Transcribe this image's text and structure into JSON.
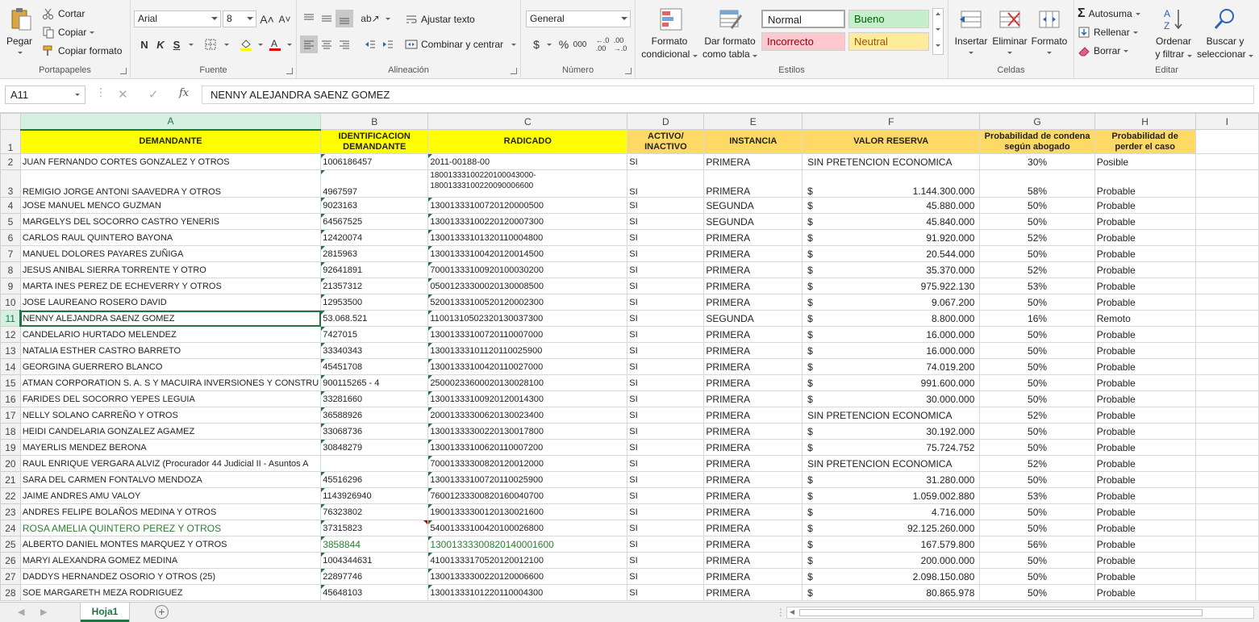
{
  "ribbon": {
    "clipboard": {
      "paste": "Pegar",
      "cut": "Cortar",
      "copy": "Copiar",
      "format_painter": "Copiar formato",
      "group": "Portapapeles"
    },
    "font": {
      "name": "Arial",
      "size": "8",
      "group": "Fuente",
      "bold": "N",
      "italic": "K",
      "underline": "S"
    },
    "alignment": {
      "wrap": "Ajustar texto",
      "merge": "Combinar y centrar",
      "group": "Alineación"
    },
    "number": {
      "format": "General",
      "currency": "$",
      "percent": "%",
      "thousands": "000",
      "group": "Número"
    },
    "styles": {
      "conditional": "Formato condicional",
      "conditional_l1": "Formato",
      "conditional_l2": "condicional",
      "table_l1": "Dar formato",
      "table_l2": "como tabla",
      "normal": "Normal",
      "good": "Bueno",
      "bad": "Incorrecto",
      "neutral": "Neutral",
      "group": "Estilos"
    },
    "cells": {
      "insert": "Insertar",
      "delete": "Eliminar",
      "format": "Formato",
      "group": "Celdas"
    },
    "editing": {
      "autosum": "Autosuma",
      "fill": "Rellenar",
      "clear": "Borrar",
      "sort_l1": "Ordenar",
      "sort_l2": "y filtrar",
      "find_l1": "Buscar y",
      "find_l2": "seleccionar",
      "group": "Editar"
    }
  },
  "formula_bar": {
    "name_box": "A11",
    "cancel": "✕",
    "enter": "✓",
    "fx": "fx",
    "value": "NENNY ALEJANDRA SAENZ GOMEZ"
  },
  "columns": [
    "A",
    "B",
    "C",
    "D",
    "E",
    "F",
    "G",
    "H",
    "I"
  ],
  "header_row": {
    "A": "DEMANDANTE",
    "B": "IDENTIFICACION DEMANDANTE",
    "C": "RADICADO",
    "D": "ACTIVO/ INACTIVO",
    "E": "INSTANCIA",
    "F": "VALOR RESERVA",
    "G": "Probabilidad de condena según abogado",
    "H": "Probabilidad de perder el caso"
  },
  "currency_symbol": "$",
  "rows": [
    {
      "n": "2",
      "a": "JUAN FERNANDO CORTES GONZALEZ Y OTROS",
      "b": "1006186457",
      "c": "2011-00188-00",
      "d": "SI",
      "e": "PRIMERA",
      "f": "SIN PRETENCION ECONOMICA",
      "g": "30%",
      "h": "Posible"
    },
    {
      "n": "3",
      "a": "REMIGIO JORGE ANTONI SAAVEDRA Y OTROS",
      "b": "4967597",
      "c": "18001333100220100043000- 18001333100220090006600",
      "d": "SI",
      "e": "PRIMERA",
      "f": "1.144.300.000",
      "g": "58%",
      "h": "Probable"
    },
    {
      "n": "4",
      "a": "JOSE MANUEL MENCO GUZMAN",
      "b": "9023163",
      "c": "13001333100720120000500",
      "d": "SI",
      "e": "SEGUNDA",
      "f": "45.880.000",
      "g": "50%",
      "h": "Probable"
    },
    {
      "n": "5",
      "a": "MARGELYS DEL SOCORRO CASTRO YENERIS",
      "b": "64567525",
      "c": "13001333100220120007300",
      "d": "SI",
      "e": "SEGUNDA",
      "f": "45.840.000",
      "g": "50%",
      "h": "Probable"
    },
    {
      "n": "6",
      "a": "CARLOS RAUL QUINTERO BAYONA",
      "b": "12420074",
      "c": "13001333101320110004800",
      "d": "SI",
      "e": "PRIMERA",
      "f": "91.920.000",
      "g": "52%",
      "h": "Probable"
    },
    {
      "n": "7",
      "a": "MANUEL DOLORES PAYARES ZUÑIGA",
      "b": "2815963",
      "c": "13001333100420120014500",
      "d": "SI",
      "e": "PRIMERA",
      "f": "20.544.000",
      "g": "50%",
      "h": "Probable"
    },
    {
      "n": "8",
      "a": "JESUS ANIBAL SIERRA TORRENTE Y OTRO",
      "b": "92641891",
      "c": "70001333100920100030200",
      "d": "SI",
      "e": "PRIMERA",
      "f": "35.370.000",
      "g": "52%",
      "h": "Probable"
    },
    {
      "n": "9",
      "a": "MARTA INES PEREZ DE ECHEVERRY Y OTROS",
      "b": "21357312",
      "c": "05001233300020130008500",
      "d": "SI",
      "e": "PRIMERA",
      "f": "975.922.130",
      "g": "53%",
      "h": "Probable"
    },
    {
      "n": "10",
      "a": "JOSE LAUREANO ROSERO DAVID",
      "b": "12953500",
      "c": "52001333100520120002300",
      "d": "SI",
      "e": "PRIMERA",
      "f": "9.067.200",
      "g": "50%",
      "h": "Probable"
    },
    {
      "n": "11",
      "a": "NENNY ALEJANDRA SAENZ GOMEZ",
      "b": "53.068.521",
      "c": "11001310502320130037300",
      "d": "SI",
      "e": "SEGUNDA",
      "f": "8.800.000",
      "g": "16%",
      "h": "Remoto"
    },
    {
      "n": "12",
      "a": "CANDELARIO HURTADO MELENDEZ",
      "b": "7427015",
      "c": "13001333100720110007000",
      "d": "SI",
      "e": "PRIMERA",
      "f": "16.000.000",
      "g": "50%",
      "h": "Probable"
    },
    {
      "n": "13",
      "a": "NATALIA ESTHER CASTRO BARRETO",
      "b": "33340343",
      "c": "13001333101120110025900",
      "d": "SI",
      "e": "PRIMERA",
      "f": "16.000.000",
      "g": "50%",
      "h": "Probable"
    },
    {
      "n": "14",
      "a": "GEORGINA GUERRERO BLANCO",
      "b": "45451708",
      "c": "13001333100420110027000",
      "d": "SI",
      "e": "PRIMERA",
      "f": "74.019.200",
      "g": "50%",
      "h": "Probable"
    },
    {
      "n": "15",
      "a": "ATMAN CORPORATION S. A. S Y MACUIRA INVERSIONES Y CONSTRU",
      "b": "900115265 - 4",
      "c": "25000233600020130028100",
      "d": "SI",
      "e": "PRIMERA",
      "f": "991.600.000",
      "g": "50%",
      "h": "Probable"
    },
    {
      "n": "16",
      "a": "FARIDES DEL SOCORRO YEPES LEGUIA",
      "b": "33281660",
      "c": "13001333100920120014300",
      "d": "SI",
      "e": "PRIMERA",
      "f": "30.000.000",
      "g": "50%",
      "h": "Probable"
    },
    {
      "n": "17",
      "a": "NELLY SOLANO CARREÑO Y OTROS",
      "b": "36588926",
      "c": "20001333300620130023400",
      "d": "SI",
      "e": "PRIMERA",
      "f": "SIN PRETENCION ECONOMICA",
      "g": "52%",
      "h": "Probable"
    },
    {
      "n": "18",
      "a": "HEIDI CANDELARIA GONZALEZ AGAMEZ",
      "b": "33068736",
      "c": "13001333300220130017800",
      "d": "SI",
      "e": "PRIMERA",
      "f": "30.192.000",
      "g": "50%",
      "h": "Probable"
    },
    {
      "n": "19",
      "a": "MAYERLIS MENDEZ  BERONA",
      "b": "30848279",
      "c": "13001333100620110007200",
      "d": "SI",
      "e": "PRIMERA",
      "f": "75.724.752",
      "g": "50%",
      "h": "Probable"
    },
    {
      "n": "20",
      "a": "RAUL ENRIQUE VERGARA ALVIZ (Procurador 44 Judicial II - Asuntos A",
      "b": "",
      "c": "70001333300820120012000",
      "d": "SI",
      "e": "PRIMERA",
      "f": "SIN PRETENCION ECONOMICA",
      "g": "52%",
      "h": "Probable"
    },
    {
      "n": "21",
      "a": "SARA DEL CARMEN FONTALVO MENDOZA",
      "b": "45516296",
      "c": "13001333100720110025900",
      "d": "SI",
      "e": "PRIMERA",
      "f": "31.280.000",
      "g": "50%",
      "h": "Probable"
    },
    {
      "n": "22",
      "a": "JAIME ANDRES AMU VALOY",
      "b": "1143926940",
      "c": "76001233300820160040700",
      "d": "SI",
      "e": "PRIMERA",
      "f": "1.059.002.880",
      "g": "53%",
      "h": "Probable"
    },
    {
      "n": "23",
      "a": "ANDRES FELIPE BOLAÑOS MEDINA Y OTROS",
      "b": "76323802",
      "c": "19001333300120130021600",
      "d": "SI",
      "e": "PRIMERA",
      "f": "4.716.000",
      "g": "50%",
      "h": "Probable"
    },
    {
      "n": "24",
      "a": "ROSA AMELIA QUINTERO PEREZ Y OTROS",
      "b": "37315823",
      "c": "54001333100420100026800",
      "d": "SI",
      "e": "PRIMERA",
      "f": "92.125.260.000",
      "g": "50%",
      "h": "Probable"
    },
    {
      "n": "25",
      "a": "ALBERTO DANIEL MONTES MARQUEZ Y OTROS",
      "b": "3858844",
      "c": "13001333300820140001600",
      "d": "SI",
      "e": "PRIMERA",
      "f": "167.579.800",
      "g": "56%",
      "h": "Probable"
    },
    {
      "n": "26",
      "a": "MARYI ALEXANDRA GOMEZ MEDINA",
      "b": "1004344631",
      "c": "41001333170520120012100",
      "d": "SI",
      "e": "PRIMERA",
      "f": "200.000.000",
      "g": "50%",
      "h": "Probable"
    },
    {
      "n": "27",
      "a": "DADDYS HERNANDEZ OSORIO Y OTROS (25)",
      "b": "22897746",
      "c": "13001333300220120006600",
      "d": "SI",
      "e": "PRIMERA",
      "f": "2.098.150.080",
      "g": "50%",
      "h": "Probable"
    },
    {
      "n": "28",
      "a": "SOE MARGARETH MEZA RODRIGUEZ",
      "b": "45648103",
      "c": "13001333101220110004300",
      "d": "SI",
      "e": "PRIMERA",
      "f": "80.865.978",
      "g": "50%",
      "h": "Probable"
    }
  ],
  "sheet_tabs": {
    "active": "Hoja1",
    "add": "+"
  },
  "colors": {
    "accent": "#217346",
    "header_yellow": "#ffff00",
    "header_orange": "#ffd966",
    "good_bg": "#c6efce",
    "bad_bg": "#ffc7ce",
    "neutral_bg": "#ffeb9c"
  }
}
